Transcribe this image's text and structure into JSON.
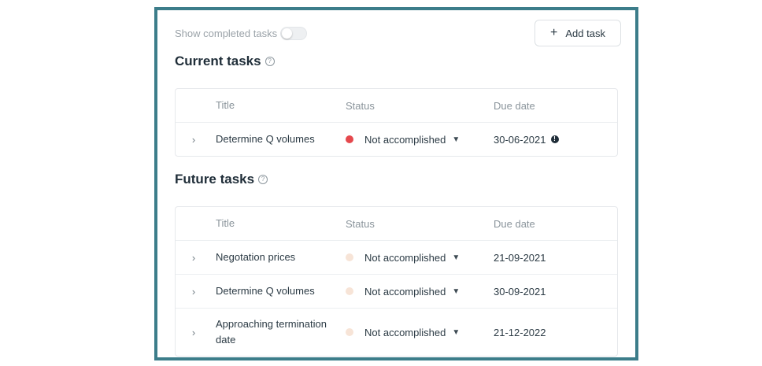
{
  "header": {
    "show_completed_label": "Show completed tasks",
    "add_task_label": "Add task"
  },
  "columns": {
    "title": "Title",
    "status": "Status",
    "due": "Due date"
  },
  "current": {
    "heading": "Current tasks",
    "rows": [
      {
        "title": "Determine Q volumes",
        "status": "Not accomplished",
        "due": "30-06-2021"
      }
    ]
  },
  "future": {
    "heading": "Future tasks",
    "rows": [
      {
        "title": "Negotation prices",
        "status": "Not accomplished",
        "due": "21-09-2021"
      },
      {
        "title": "Determine Q volumes",
        "status": "Not accomplished",
        "due": "30-09-2021"
      },
      {
        "title": "Approaching termination date",
        "status": "Not accomplished",
        "due": "21-12-2022"
      }
    ]
  },
  "colors": {
    "frame": "#3c7d8a",
    "overdue_status": "#e5484d",
    "upcoming_status": "#f7e4d7"
  },
  "icons": {
    "help": "question-circle-icon",
    "expand": "chevron-right-icon",
    "dropdown": "chevron-down-icon",
    "warning": "exclamation-circle-icon",
    "add": "plus-icon"
  }
}
